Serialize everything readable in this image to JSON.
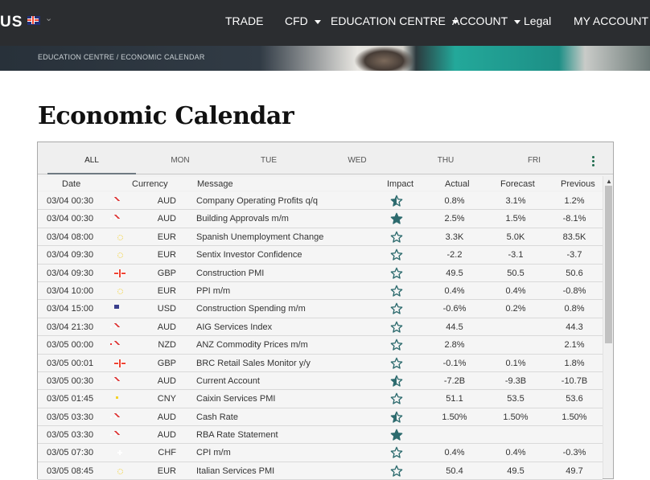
{
  "header": {
    "logo_text": "US",
    "language": "UK",
    "nav": [
      {
        "label": "TRADE",
        "dropdown": false
      },
      {
        "label": "CFD",
        "dropdown": true
      },
      {
        "label": "EDUCATION CENTRE",
        "dropdown": true
      },
      {
        "label": "ACCOUNT",
        "dropdown": true
      },
      {
        "label": "Legal",
        "dropdown": false
      },
      {
        "label": "MY ACCOUNT",
        "dropdown": false
      }
    ]
  },
  "breadcrumb": "EDUCATION CENTRE / ECONOMIC CALENDAR",
  "page_title": "Economic Calendar",
  "calendar": {
    "tabs": [
      "ALL",
      "MON",
      "TUE",
      "WED",
      "THU",
      "FRI"
    ],
    "active_tab": "ALL",
    "columns": {
      "date": "Date",
      "currency": "Currency",
      "message": "Message",
      "impact": "Impact",
      "actual": "Actual",
      "forecast": "Forecast",
      "previous": "Previous"
    },
    "rows": [
      {
        "date": "03/04 00:30",
        "flag": "au",
        "currency": "AUD",
        "message": "Company Operating Profits q/q",
        "impact": "medium",
        "actual": "0.8%",
        "forecast": "3.1%",
        "previous": "1.2%"
      },
      {
        "date": "03/04 00:30",
        "flag": "au",
        "currency": "AUD",
        "message": "Building Approvals m/m",
        "impact": "high",
        "actual": "2.5%",
        "forecast": "1.5%",
        "previous": "-8.1%"
      },
      {
        "date": "03/04 08:00",
        "flag": "eu",
        "currency": "EUR",
        "message": "Spanish Unemployment Change",
        "impact": "low",
        "actual": "3.3K",
        "forecast": "5.0K",
        "previous": "83.5K"
      },
      {
        "date": "03/04 09:30",
        "flag": "eu",
        "currency": "EUR",
        "message": "Sentix Investor Confidence",
        "impact": "low",
        "actual": "-2.2",
        "forecast": "-3.1",
        "previous": "-3.7"
      },
      {
        "date": "03/04 09:30",
        "flag": "gb",
        "currency": "GBP",
        "message": "Construction PMI",
        "impact": "low",
        "actual": "49.5",
        "forecast": "50.5",
        "previous": "50.6"
      },
      {
        "date": "03/04 10:00",
        "flag": "eu",
        "currency": "EUR",
        "message": "PPI m/m",
        "impact": "low",
        "actual": "0.4%",
        "forecast": "0.4%",
        "previous": "-0.8%"
      },
      {
        "date": "03/04 15:00",
        "flag": "us",
        "currency": "USD",
        "message": "Construction Spending m/m",
        "impact": "low",
        "actual": "-0.6%",
        "forecast": "0.2%",
        "previous": "0.8%"
      },
      {
        "date": "03/04 21:30",
        "flag": "au",
        "currency": "AUD",
        "message": "AIG Services Index",
        "impact": "low",
        "actual": "44.5",
        "forecast": "",
        "previous": "44.3"
      },
      {
        "date": "03/05 00:00",
        "flag": "nz",
        "currency": "NZD",
        "message": "ANZ Commodity Prices m/m",
        "impact": "low",
        "actual": "2.8%",
        "forecast": "",
        "previous": "2.1%"
      },
      {
        "date": "03/05 00:01",
        "flag": "gb",
        "currency": "GBP",
        "message": "BRC Retail Sales Monitor y/y",
        "impact": "low",
        "actual": "-0.1%",
        "forecast": "0.1%",
        "previous": "1.8%"
      },
      {
        "date": "03/05 00:30",
        "flag": "au",
        "currency": "AUD",
        "message": "Current Account",
        "impact": "medium",
        "actual": "-7.2B",
        "forecast": "-9.3B",
        "previous": "-10.7B"
      },
      {
        "date": "03/05 01:45",
        "flag": "cn",
        "currency": "CNY",
        "message": "Caixin Services PMI",
        "impact": "low",
        "actual": "51.1",
        "forecast": "53.5",
        "previous": "53.6"
      },
      {
        "date": "03/05 03:30",
        "flag": "au",
        "currency": "AUD",
        "message": "Cash Rate",
        "impact": "medium",
        "actual": "1.50%",
        "forecast": "1.50%",
        "previous": "1.50%"
      },
      {
        "date": "03/05 03:30",
        "flag": "au",
        "currency": "AUD",
        "message": "RBA Rate Statement",
        "impact": "high",
        "actual": "",
        "forecast": "",
        "previous": ""
      },
      {
        "date": "03/05 07:30",
        "flag": "ch",
        "currency": "CHF",
        "message": "CPI m/m",
        "impact": "low",
        "actual": "0.4%",
        "forecast": "0.4%",
        "previous": "-0.3%"
      },
      {
        "date": "03/05 08:45",
        "flag": "eu",
        "currency": "EUR",
        "message": "Italian Services PMI",
        "impact": "low",
        "actual": "50.4",
        "forecast": "49.5",
        "previous": "49.7"
      }
    ]
  },
  "colors": {
    "nav_bg": "#2b2d30",
    "star": "#2d6b6e"
  }
}
